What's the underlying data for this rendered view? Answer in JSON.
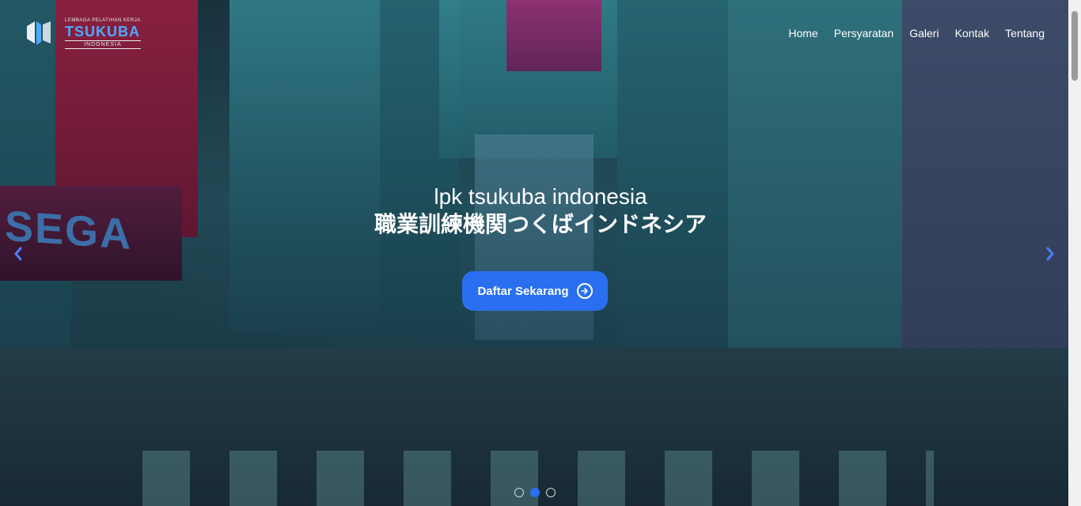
{
  "logo": {
    "tagline": "LEMBAGA PELATIHAN KERJA",
    "name": "TSUKUBA",
    "country": "INDONESIA"
  },
  "nav": {
    "items": [
      "Home",
      "Persyaratan",
      "Galeri",
      "Kontak",
      "Tentang"
    ]
  },
  "hero": {
    "title": "lpk tsukuba indonesia",
    "subtitle": "職業訓練機関つくばインドネシア",
    "cta_label": "Daftar Sekarang",
    "cta_icon": "arrow-right-circle-icon",
    "sign_text": "SEGA"
  },
  "carousel": {
    "prev_icon": "chevron-left-icon",
    "next_icon": "chevron-right-icon",
    "slide_count": 3,
    "active_slide": 2
  },
  "colors": {
    "accent": "#2a6ff0",
    "logo_blue": "#4fa8ff"
  }
}
